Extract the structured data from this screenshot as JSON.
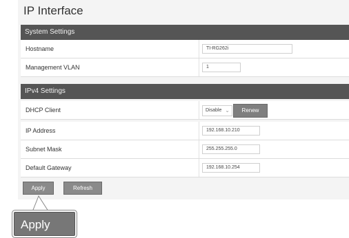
{
  "page": {
    "title": "IP Interface"
  },
  "system_settings": {
    "header": "System Settings",
    "hostname": {
      "label": "Hostname",
      "value": "TI-RG262i"
    },
    "management_vlan": {
      "label": "Management VLAN",
      "value": "1"
    }
  },
  "ipv4_settings": {
    "header": "IPv4 Settings",
    "dhcp_client": {
      "label": "DHCP Client",
      "selected": "Disable",
      "renew_label": "Renew"
    },
    "ip_address": {
      "label": "IP Address",
      "value": "192.168.10.210"
    },
    "subnet_mask": {
      "label": "Subnet Mask",
      "value": "255.255.255.0"
    },
    "default_gateway": {
      "label": "Default Gateway",
      "value": "192.168.10.254"
    }
  },
  "actions": {
    "apply_label": "Apply",
    "refresh_label": "Refresh"
  },
  "callout": {
    "text": "Apply"
  },
  "icons": {
    "select_chevron": "chevron-down-icon"
  }
}
